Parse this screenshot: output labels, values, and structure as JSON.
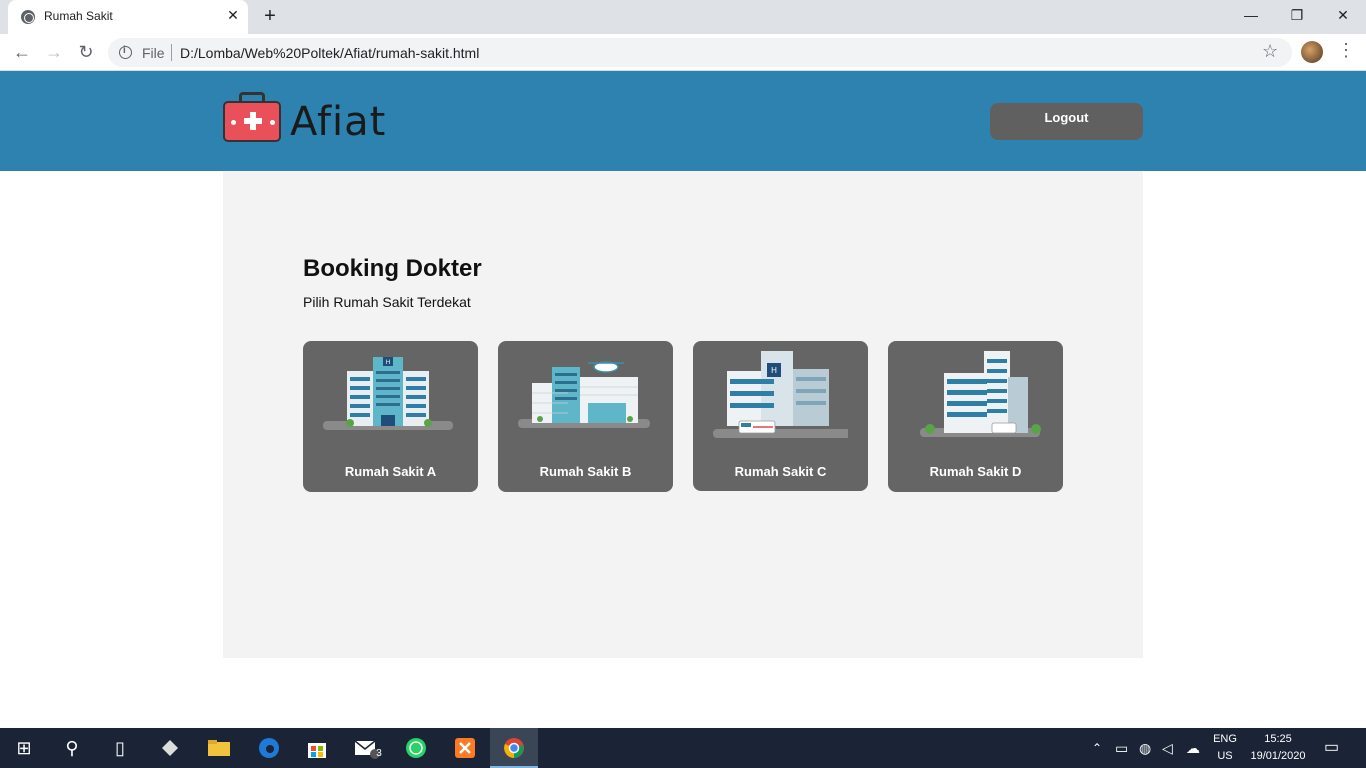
{
  "browser": {
    "tab_title": "Rumah Sakit",
    "tab_close": "✕",
    "new_tab": "+",
    "window_controls": {
      "minimize": "—",
      "restore": "❐",
      "close": "✕"
    },
    "back": "←",
    "forward": "→",
    "reload": "↻",
    "url_scheme_label": "File",
    "url": "D:/Lomba/Web%20Poltek/Afiat/rumah-sakit.html",
    "star": "☆",
    "menu": "⋮"
  },
  "header": {
    "brand": "Afiat",
    "logout_label": "Logout",
    "brand_color": "#2d82b0"
  },
  "main": {
    "title": "Booking Dokter",
    "subtitle": "Pilih Rumah Sakit Terdekat",
    "hospitals": [
      {
        "label": "Rumah Sakit A",
        "icon": "hospital-building-icon"
      },
      {
        "label": "Rumah Sakit B",
        "icon": "hospital-helipad-icon"
      },
      {
        "label": "Rumah Sakit C",
        "icon": "hospital-ambulance-icon"
      },
      {
        "label": "Rumah Sakit D",
        "icon": "hospital-tower-icon"
      }
    ]
  },
  "taskbar": {
    "start": "⊞",
    "search": "⚲",
    "task_view": "▯",
    "mail_badge": "3",
    "lang_line1": "ENG",
    "lang_line2": "US",
    "time": "15:25",
    "date": "19/01/2020"
  }
}
